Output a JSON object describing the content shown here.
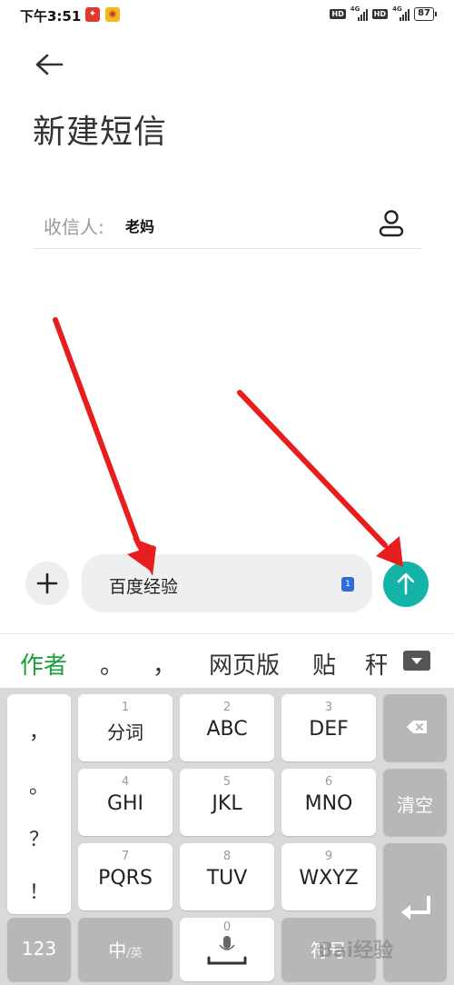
{
  "status_bar": {
    "time": "下午3:51",
    "hd1": "HD",
    "net1": "4G",
    "hd2": "HD",
    "net2": "4G",
    "battery": "87"
  },
  "header": {
    "title": "新建短信"
  },
  "recipient": {
    "label": "收信人:",
    "value": "老妈"
  },
  "compose": {
    "text": "百度经验",
    "sim": "1"
  },
  "candidates": [
    "作者",
    "。",
    "，",
    "网页版",
    "贴",
    "秆"
  ],
  "keyboard": {
    "punct": [
      "，",
      "。",
      "？",
      "！"
    ],
    "keys": [
      {
        "num": "1",
        "label": "分词"
      },
      {
        "num": "2",
        "label": "ABC"
      },
      {
        "num": "3",
        "label": "DEF"
      },
      {
        "num": "4",
        "label": "GHI"
      },
      {
        "num": "5",
        "label": "JKL"
      },
      {
        "num": "6",
        "label": "MNO"
      },
      {
        "num": "7",
        "label": "PQRS"
      },
      {
        "num": "8",
        "label": "TUV"
      },
      {
        "num": "9",
        "label": "WXYZ"
      }
    ],
    "clear": "清空",
    "num_mode": "123",
    "lang_main": "中",
    "lang_sub": "/英",
    "space_num": "0",
    "symbols": "符号"
  },
  "watermark": "Bai经验",
  "colors": {
    "send": "#14b3a8",
    "candidate_active": "#1aa23a",
    "arrow": "#e81e1e"
  }
}
